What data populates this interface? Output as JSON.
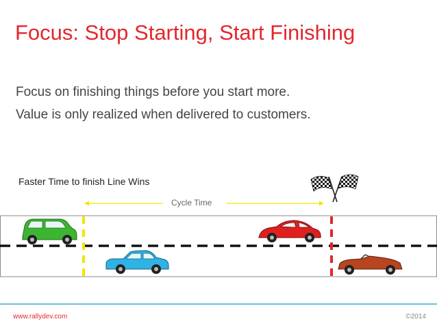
{
  "slide": {
    "title": "Focus: Stop Starting, Start Finishing",
    "bullets": [
      "Focus on finishing things before you start more.",
      "Value is only realized when delivered to customers."
    ],
    "race_caption": "Faster Time to finish Line Wins",
    "cycle_label": "Cycle Time"
  },
  "footer": {
    "website": "www.rallydev.com",
    "copyright": "©2014"
  },
  "colors": {
    "title": "#e3262d",
    "start_line": "#f2e600",
    "finish_line": "#e3262d",
    "footer_rule": "#3aa6d8"
  },
  "icons": [
    "checkered-flags-icon",
    "green-car-icon",
    "blue-car-icon",
    "red-sports-car-icon",
    "red-convertible-icon"
  ]
}
